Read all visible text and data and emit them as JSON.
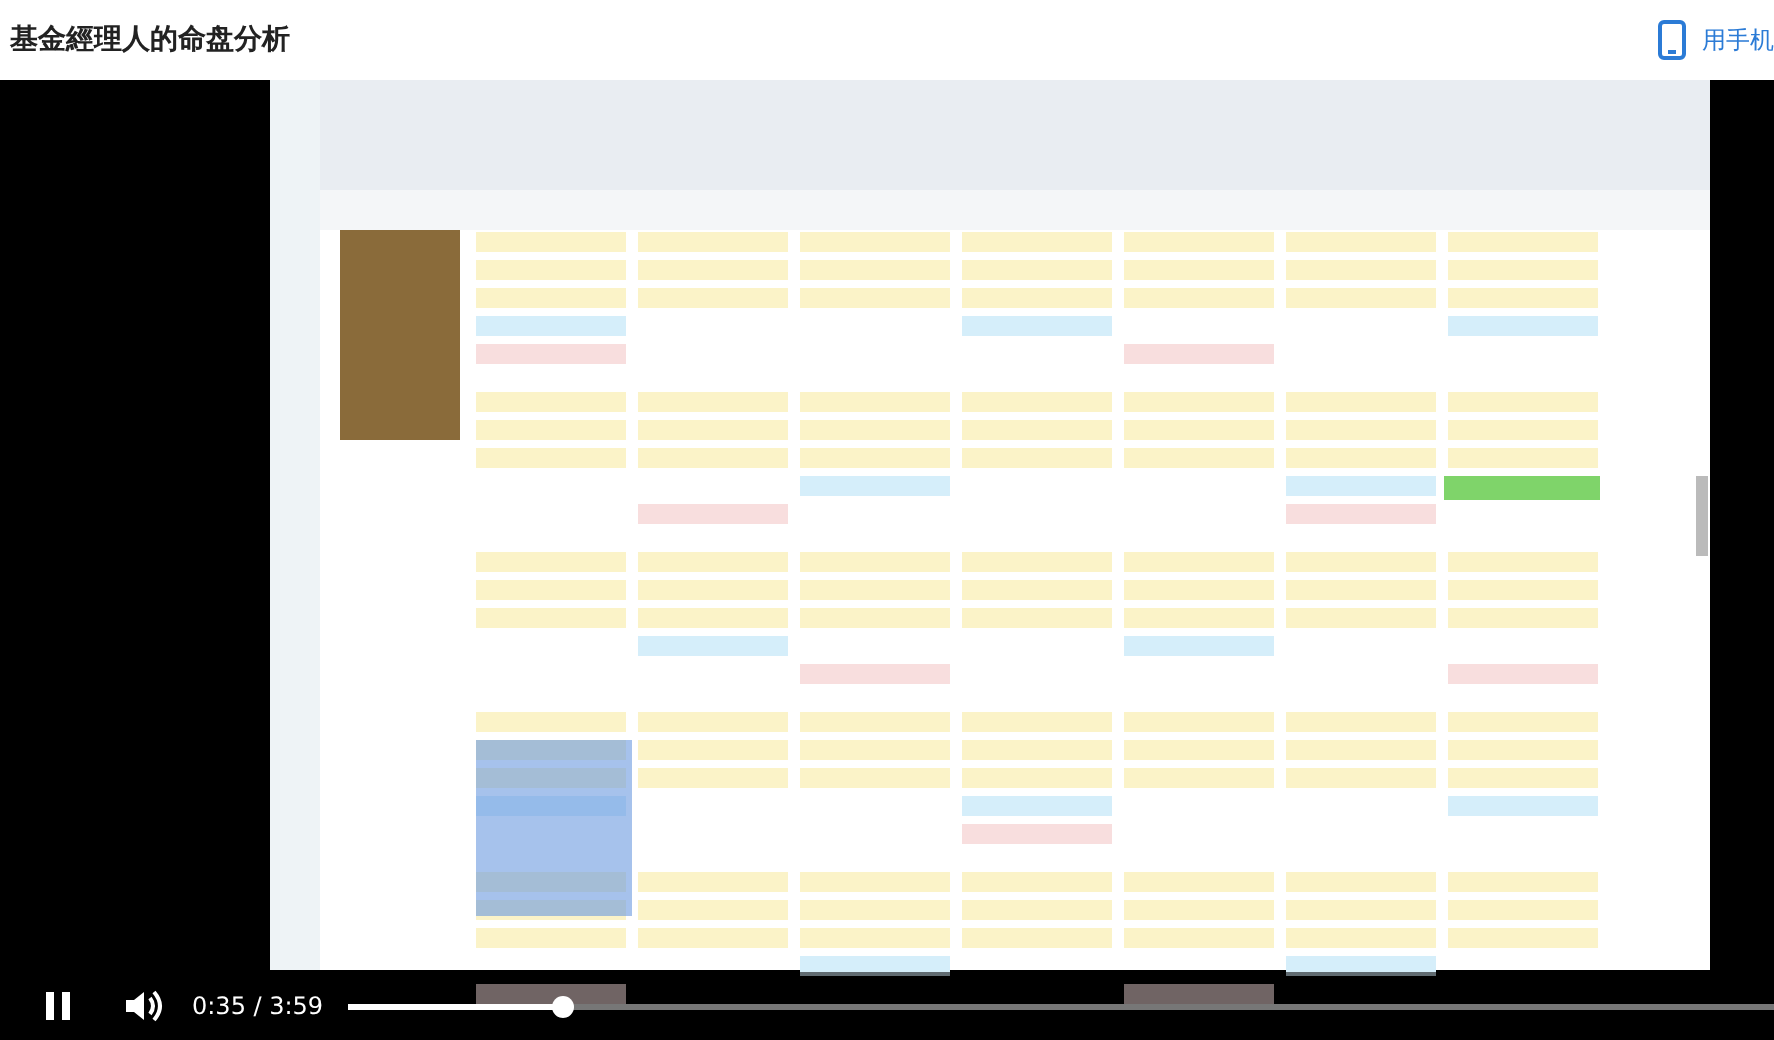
{
  "page_title": "基金經理人的命盘分析",
  "header_link": {
    "label": "用手机"
  },
  "video": {
    "kind": "picture",
    "playing": true,
    "time": "0:35 / 3:59",
    "progress": {
      "level": 0.15
    }
  }
}
